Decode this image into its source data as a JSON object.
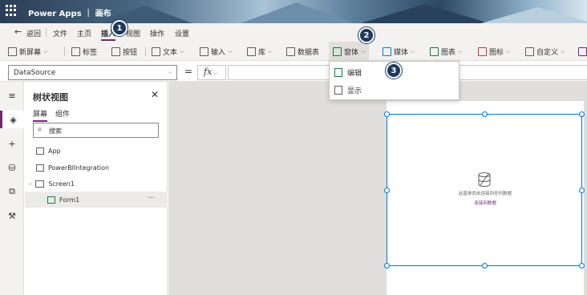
{
  "app": {
    "title": "Power Apps ｜ 画布"
  },
  "menu": {
    "back": "返回",
    "items": [
      "文件",
      "主页",
      "插入",
      "视图",
      "操作",
      "设置"
    ],
    "active_index": 2
  },
  "toolbar": {
    "items": [
      {
        "label": "新屏幕",
        "icon": "new-screen-icon",
        "has_chevron": true
      },
      {
        "label": "标签",
        "icon": "label-icon",
        "has_chevron": false
      },
      {
        "label": "按钮",
        "icon": "button-icon",
        "has_chevron": false
      },
      {
        "label": "文本",
        "icon": "text-icon",
        "has_chevron": true
      },
      {
        "label": "输入",
        "icon": "input-icon",
        "has_chevron": true
      },
      {
        "label": "库",
        "icon": "gallery-icon",
        "has_chevron": true
      },
      {
        "label": "数据表",
        "icon": "data-table-icon",
        "has_chevron": false
      },
      {
        "label": "窗体",
        "icon": "form-icon",
        "has_chevron": true
      },
      {
        "label": "媒体",
        "icon": "media-icon",
        "has_chevron": true
      },
      {
        "label": "图表",
        "icon": "chart-icon",
        "has_chevron": true
      },
      {
        "label": "图标",
        "icon": "icons-icon",
        "has_chevron": true
      },
      {
        "label": "自定义",
        "icon": "custom-icon",
        "has_chevron": true
      }
    ]
  },
  "formula": {
    "property": "DataSource",
    "equals": "=",
    "fx": "fx",
    "value": ""
  },
  "tree": {
    "title": "树状视图",
    "tabs": [
      "屏幕",
      "组件"
    ],
    "search_placeholder": "搜索",
    "nodes": [
      {
        "label": "App"
      },
      {
        "label": "PowerBIIntegration"
      },
      {
        "label": "Screen1"
      },
      {
        "label": "Form1"
      }
    ]
  },
  "form": {
    "message": "此窗体尚未连接到任何数据",
    "link": "连接到数据"
  },
  "dropdown": {
    "items": [
      "编辑",
      "显示"
    ]
  },
  "steps": [
    "1",
    "2",
    "3"
  ],
  "colors": {
    "accent": "#742774",
    "selection": "#0078d4",
    "step_marker": "#1f3a5f"
  }
}
